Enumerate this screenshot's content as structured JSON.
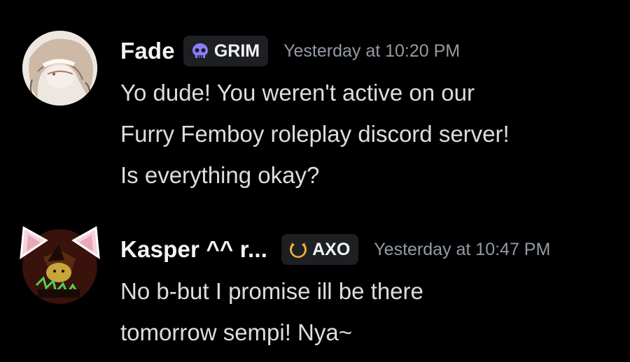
{
  "messages": [
    {
      "username": "Fade",
      "tag": {
        "icon": "skull-icon",
        "label": "GRIM",
        "icon_color": "#8b7cf6"
      },
      "timestamp": "Yesterday at 10:20 PM",
      "lines": [
        "Yo dude! You weren't active on our",
        "Furry Femboy roleplay discord server!",
        "Is everything okay?"
      ]
    },
    {
      "username": "Kasper ^^ r...",
      "tag": {
        "icon": "crescent-moon-icon",
        "label": "AXO",
        "icon_color": "#f0b132"
      },
      "timestamp": "Yesterday at 10:47 PM",
      "lines": [
        "No b-but I promise ill be there",
        "tomorrow sempi! Nya~"
      ]
    }
  ],
  "colors": {
    "background": "#000000",
    "username": "#f2f3f5",
    "message_text": "#dbdee1",
    "timestamp": "#949ba4",
    "tag_background": "#1e1f22"
  }
}
